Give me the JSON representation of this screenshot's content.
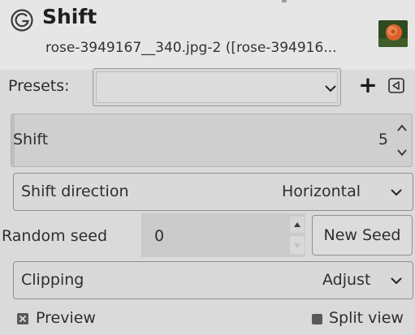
{
  "header": {
    "title": "Shift",
    "subtitle": "rose-3949167__340.jpg-2 ([rose-394916..."
  },
  "presets": {
    "label": "Presets:",
    "value": "",
    "add_label": "+"
  },
  "shift": {
    "label": "Shift",
    "value": "5"
  },
  "shift_direction": {
    "label": "Shift direction",
    "value": "Horizontal"
  },
  "random_seed": {
    "label": "Random seed",
    "value": "0",
    "new_seed_label": "New Seed"
  },
  "clipping": {
    "label": "Clipping",
    "value": "Adjust"
  },
  "preview": {
    "label": "Preview",
    "checked": true
  },
  "split_view": {
    "label": "Split view",
    "checked": false
  },
  "icons": [
    "gimp-icon",
    "image-thumbnail",
    "chevron-down-icon",
    "add-icon",
    "preset-menu-icon",
    "spin-up-icon",
    "spin-down-icon",
    "checkbox-icon"
  ]
}
